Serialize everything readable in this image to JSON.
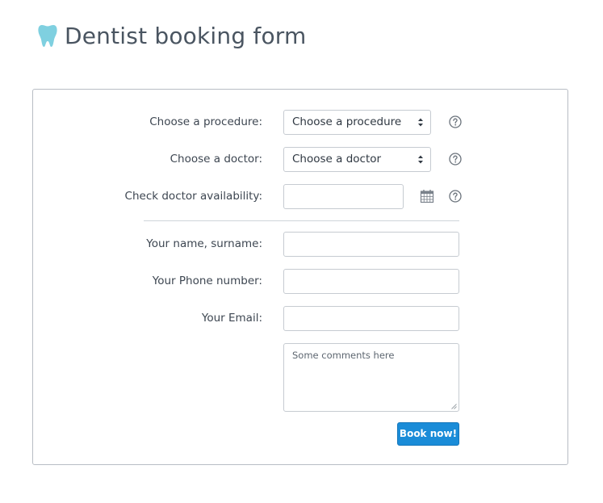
{
  "header": {
    "title": "Dentist booking form",
    "icon": "tooth-icon",
    "icon_color": "#7fd0e0"
  },
  "form": {
    "procedure": {
      "label": "Choose a procedure:",
      "selected": "Choose a procedure"
    },
    "doctor": {
      "label": "Choose a doctor:",
      "selected": "Choose a doctor"
    },
    "availability": {
      "label": "Check doctor availability:",
      "value": ""
    },
    "name": {
      "label": "Your name, surname:",
      "value": ""
    },
    "phone": {
      "label": "Your Phone number:",
      "value": ""
    },
    "email": {
      "label": "Your Email:",
      "value": ""
    },
    "comments": {
      "placeholder": "Some comments here"
    },
    "submit_label": "Book now!"
  },
  "colors": {
    "accent": "#1a8cd8",
    "border": "#c6cbd1",
    "text": "#3d4651"
  }
}
